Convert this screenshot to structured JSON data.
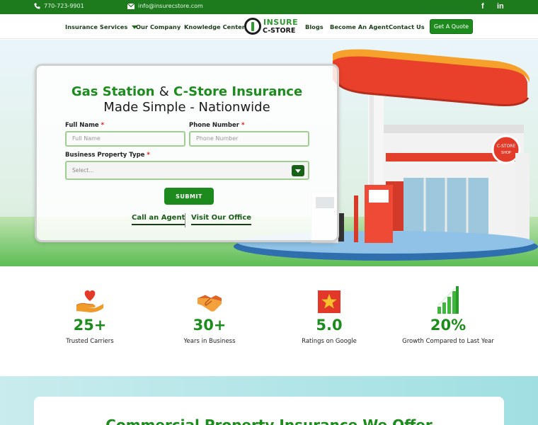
{
  "topbar": {
    "phone": "770-723-9901",
    "email": "info@insurecstore.com",
    "social": [
      {
        "icon": "facebook-icon",
        "label": "f"
      },
      {
        "icon": "linkedin-icon",
        "label": "in"
      }
    ]
  },
  "nav": {
    "insurance_services": "Insurance Services",
    "our_company": "Our Company",
    "knowledge_center": "Knowledge Center",
    "logo_line1": "INSURE",
    "logo_line2": "C-STORE",
    "blogs": "Blogs",
    "become_agent": "Become An Agent",
    "contact_us": "Contact Us",
    "quote_button": "Get A Quote"
  },
  "hero": {
    "title_part1": "Gas Station",
    "title_amp": "&",
    "title_part2": "C-Store Insurance",
    "subtitle": "Made Simple - Nationwide",
    "station_sign": "C-STORE"
  },
  "form": {
    "full_name_label": "Full Name",
    "full_name_placeholder": "Full Name",
    "phone_label": "Phone Number",
    "phone_placeholder": "Phone Number",
    "property_label": "Business Property Type",
    "property_value": "Select...",
    "required_mark": "*",
    "submit": "SUBMIT",
    "call_agent": "Call an Agent",
    "visit_office": "Visit Our Office"
  },
  "stats": [
    {
      "icon": "heart-hand-icon",
      "value": "25+",
      "label": "Trusted Carriers"
    },
    {
      "icon": "handshake-icon",
      "value": "30+",
      "label": "Years in Business"
    },
    {
      "icon": "star-badge-icon",
      "value": "5.0",
      "label": "Ratings on Google"
    },
    {
      "icon": "growth-bars-icon",
      "value": "20%",
      "label": "Growth Compared to Last Year"
    }
  ],
  "section": {
    "title": "Commercial Property Insurance We Offer"
  },
  "colors": {
    "brand_green": "#1c8c1c",
    "topbar_green": "#1d7a1d",
    "canopy_red": "#e8402a",
    "canopy_orange": "#f4a02a"
  }
}
